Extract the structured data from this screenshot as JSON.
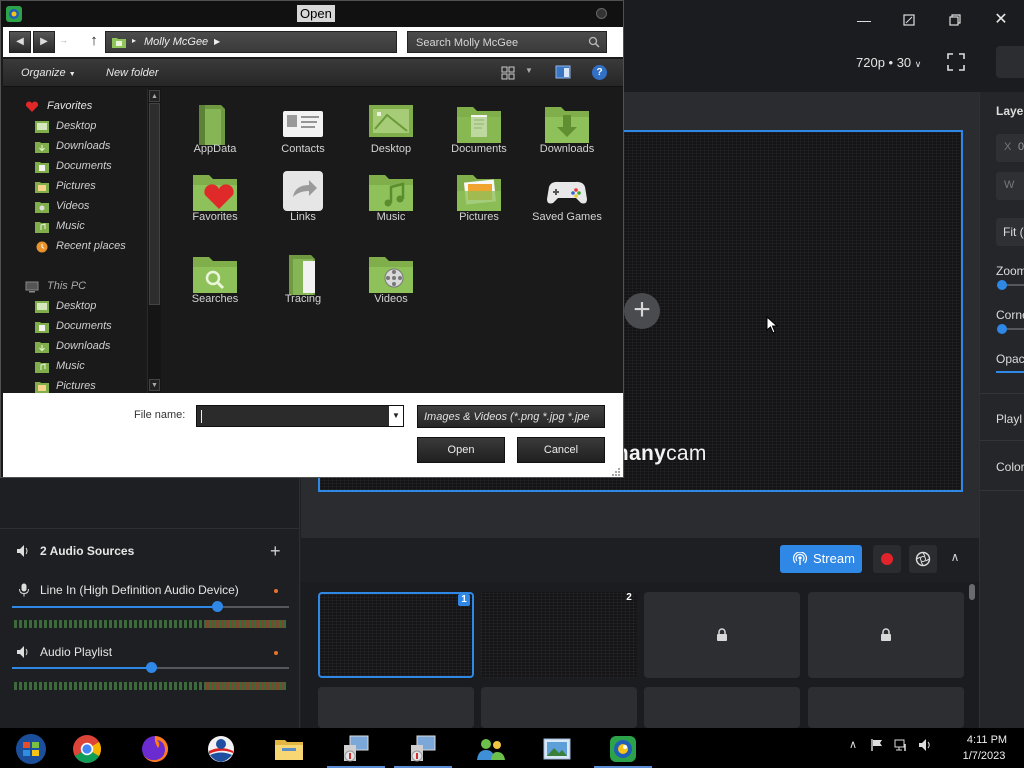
{
  "manycam": {
    "resolution": "720p • 30",
    "watermark": {
      "prefix": "many",
      "suffix": "cam"
    },
    "right_panel": {
      "layers": "Layer",
      "x_label": "X",
      "x_val": "0",
      "w_label": "W",
      "fit": "Fit (",
      "zoom": "Zoom",
      "corner": "Corne",
      "opacity": "Opac",
      "playlist": "Playl",
      "color": "Color"
    },
    "audio": {
      "header": "2 Audio Sources",
      "sources": [
        {
          "name": "Line In (High Definition Audio Device)",
          "level": 0.74
        },
        {
          "name": "Audio Playlist",
          "level": 0.5
        }
      ]
    },
    "stream_label": "Stream",
    "scenes": [
      {
        "number": "1",
        "active": true,
        "locked": false
      },
      {
        "number": "2",
        "active": false,
        "locked": false
      },
      {
        "number": "",
        "active": false,
        "locked": true
      },
      {
        "number": "",
        "active": false,
        "locked": true
      }
    ]
  },
  "dialog": {
    "title": "Open",
    "address": "Molly McGee",
    "search_placeholder": "Search Molly McGee",
    "toolbar": {
      "organize": "Organize",
      "new_folder": "New folder"
    },
    "nav": {
      "favorites": "Favorites",
      "favorite_items": [
        "Desktop",
        "Downloads",
        "Documents",
        "Pictures",
        "Videos",
        "Music",
        "Recent places"
      ],
      "this_pc": "This PC",
      "pc_items": [
        "Desktop",
        "Documents",
        "Downloads",
        "Music",
        "Pictures"
      ]
    },
    "files": [
      "AppData",
      "Contacts",
      "Desktop",
      "Documents",
      "Downloads",
      "Favorites",
      "Links",
      "Music",
      "Pictures",
      "Saved Games",
      "Searches",
      "Tracing",
      "Videos"
    ],
    "filename_label": "File name:",
    "filename_value": "",
    "filetype": "Images & Videos (*.png *.jpg *.jpe",
    "open_label": "Open",
    "cancel_label": "Cancel"
  },
  "taskbar": {
    "time": "4:11 PM",
    "date": "1/7/2023"
  },
  "colors": {
    "accent": "#2f87e6",
    "record": "#e3232b",
    "folder_green": "#7fae4a"
  }
}
